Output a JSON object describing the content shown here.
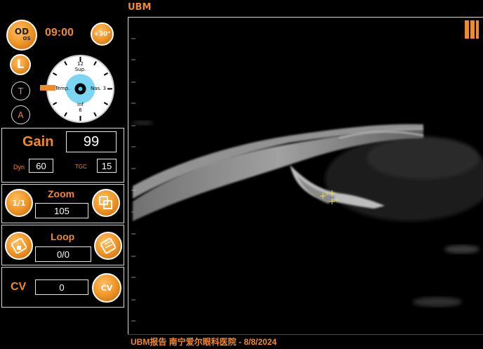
{
  "app": {
    "title": "UBM"
  },
  "header": {
    "eye_main": "OD",
    "eye_sub": "OS",
    "time": "09:00",
    "angle": "+30°"
  },
  "probe": {
    "side_label": "L",
    "t_label": "T",
    "a_label": "A"
  },
  "clock_dial": {
    "top_num": "12",
    "top_label": "Sup.",
    "left_label": "9Temp.",
    "right_label": "Nas. 3",
    "bottom_label": "Inf",
    "bottom_num": "6"
  },
  "gain": {
    "label": "Gain",
    "value": "99",
    "dyn_label": "Dyn",
    "dyn_value": "60",
    "tgc_label": "TGC",
    "tgc_value": "15"
  },
  "zoom": {
    "label": "Zoom",
    "value": "105",
    "reset_icon_text": "1/1"
  },
  "loop": {
    "label": "Loop",
    "value": "0/0"
  },
  "cv": {
    "label": "CV",
    "value": "0",
    "icon_text": "CV"
  },
  "image": {
    "marker_c1": "c",
    "marker_c2": "c"
  },
  "footer": {
    "text": "UBM报告 南宁爱尔眼科医院 - 8/8/2024"
  },
  "colors": {
    "accent": "#f08a2a",
    "border": "#d9d9d9",
    "background": "#000000",
    "marker": "#f5e04a"
  }
}
